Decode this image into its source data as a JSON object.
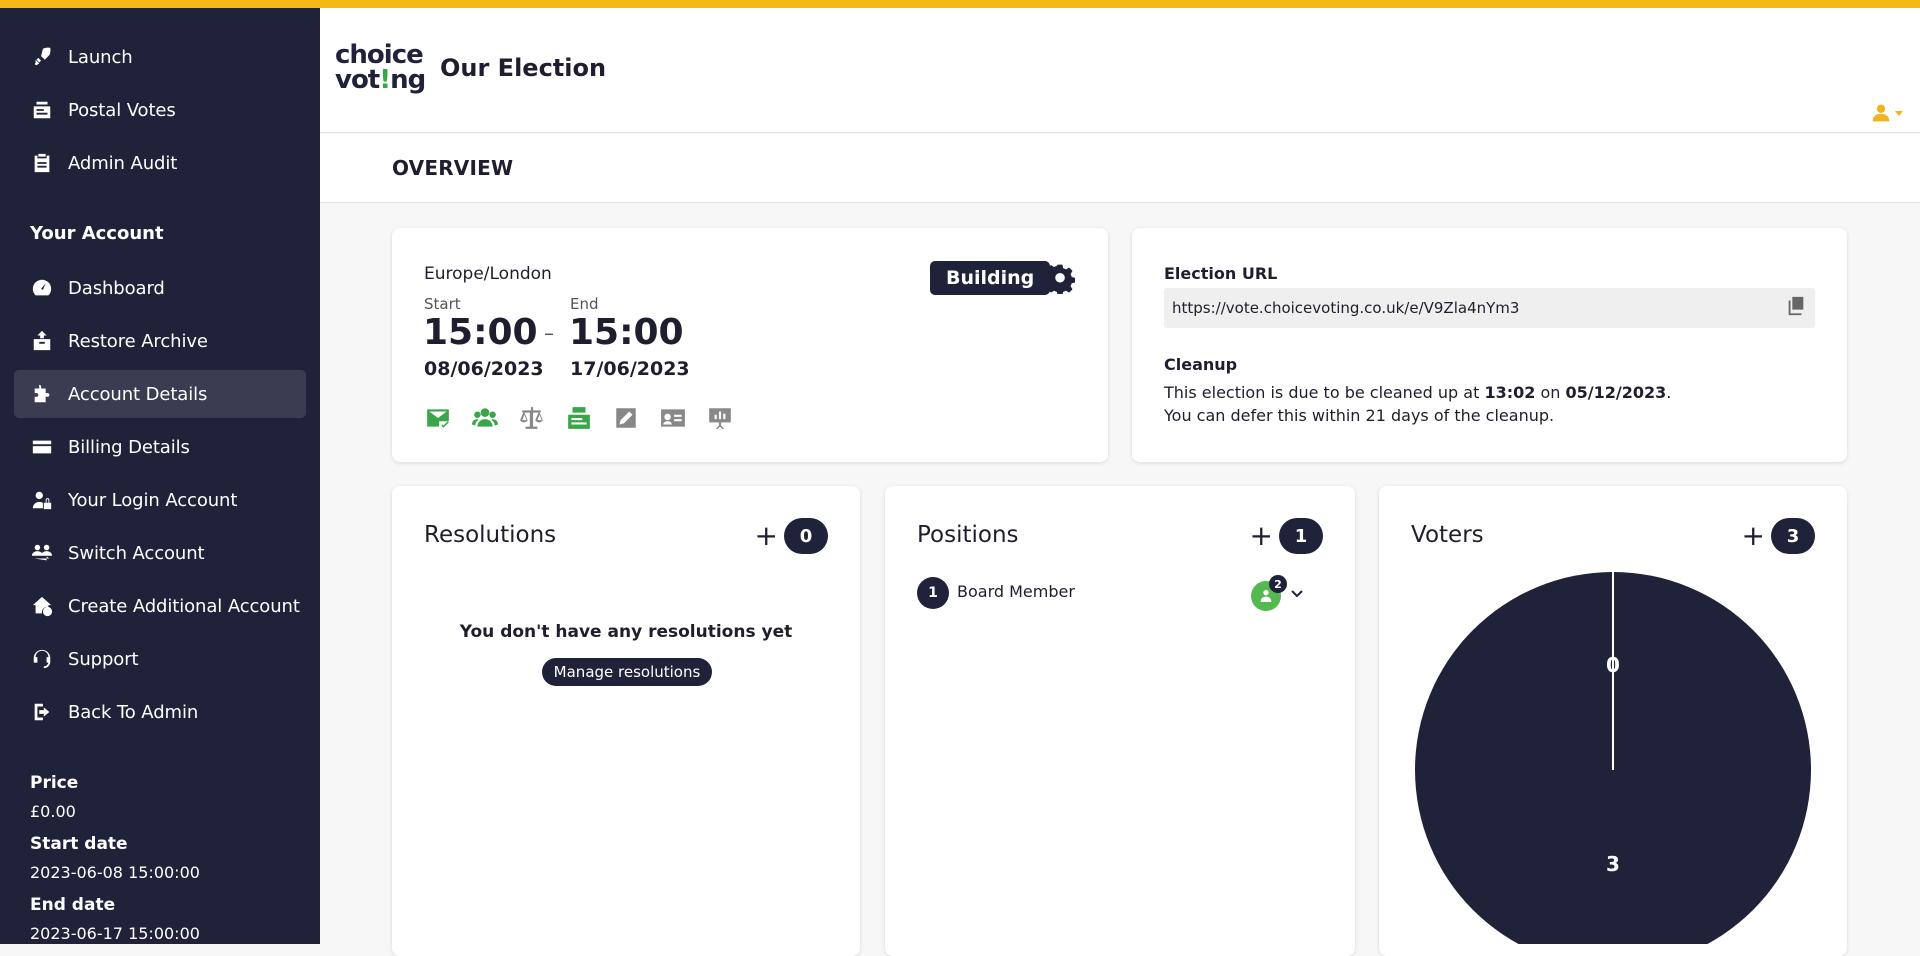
{
  "sidebar": {
    "items_top": [
      {
        "label": "Launch",
        "icon": "rocket-icon"
      },
      {
        "label": "Postal Votes",
        "icon": "postal-votes-icon"
      },
      {
        "label": "Admin Audit",
        "icon": "clipboard-icon"
      }
    ],
    "section_title": "Your Account",
    "items_account": [
      {
        "label": "Dashboard",
        "icon": "speedometer-icon"
      },
      {
        "label": "Restore Archive",
        "icon": "restore-archive-icon"
      },
      {
        "label": "Account Details",
        "icon": "puzzle-icon",
        "active": true
      },
      {
        "label": "Billing Details",
        "icon": "credit-card-icon"
      },
      {
        "label": "Your Login Account",
        "icon": "user-lock-icon"
      },
      {
        "label": "Switch Account",
        "icon": "switch-users-icon"
      },
      {
        "label": "Create Additional Account",
        "icon": "house-plus-icon"
      },
      {
        "label": "Support",
        "icon": "support-icon"
      },
      {
        "label": "Back To Admin",
        "icon": "exit-icon"
      }
    ],
    "price_label": "Price",
    "price_value": "£0.00",
    "start_label": "Start date",
    "start_value": "2023-06-08 15:00:00",
    "end_label": "End date",
    "end_value": "2023-06-17 15:00:00"
  },
  "header": {
    "logo_line1": "choice",
    "logo_line2_a": "vot",
    "logo_line2_b": "!",
    "logo_line2_c": "ng",
    "title": "Our Election",
    "user_icon": "user-icon"
  },
  "page": {
    "title": "OVERVIEW"
  },
  "schedule": {
    "timezone": "Europe/London",
    "start_label": "Start",
    "start_time": "15:00",
    "start_date": "08/06/2023",
    "separator": "–",
    "end_label": "End",
    "end_time": "15:00",
    "end_date": "17/06/2023",
    "status": "Building",
    "features": [
      {
        "icon": "email-check-icon",
        "color": "#3aa64a"
      },
      {
        "icon": "people-icon",
        "color": "#3aa64a"
      },
      {
        "icon": "scales-icon",
        "color": "#888888"
      },
      {
        "icon": "postal-icon",
        "color": "#3aa64a"
      },
      {
        "icon": "edit-icon",
        "color": "#888888"
      },
      {
        "icon": "id-card-icon",
        "color": "#888888"
      },
      {
        "icon": "presentation-icon",
        "color": "#888888"
      }
    ]
  },
  "election": {
    "url_label": "Election URL",
    "url": "https://vote.choicevoting.co.uk/e/V9Zla4nYm3",
    "cleanup_label": "Cleanup",
    "cleanup_text_a": "This election is due to be cleaned up at ",
    "cleanup_time": "13:02",
    "cleanup_text_b": " on ",
    "cleanup_date": "05/12/2023",
    "cleanup_text_c": ".",
    "defer_text": "You can defer this within 21 days of the cleanup."
  },
  "resolutions": {
    "title": "Resolutions",
    "plus": "+",
    "count": "0",
    "empty_text": "You don't have any resolutions yet",
    "manage_label": "Manage resolutions"
  },
  "positions": {
    "title": "Positions",
    "plus": "+",
    "count": "1",
    "items": [
      {
        "number": "1",
        "name": "Board Member",
        "candidates": "2"
      }
    ]
  },
  "voters": {
    "title": "Voters",
    "plus": "+",
    "count": "3"
  },
  "chart_data": {
    "type": "pie",
    "categories": [
      "",
      ""
    ],
    "values": [
      0,
      3
    ],
    "labels": [
      "0",
      "3"
    ],
    "colors": [
      "#ffffff",
      "#20223a"
    ]
  },
  "colors": {
    "accent": "#f5b917",
    "sidebar": "#20223a",
    "green": "#3aa64a"
  }
}
